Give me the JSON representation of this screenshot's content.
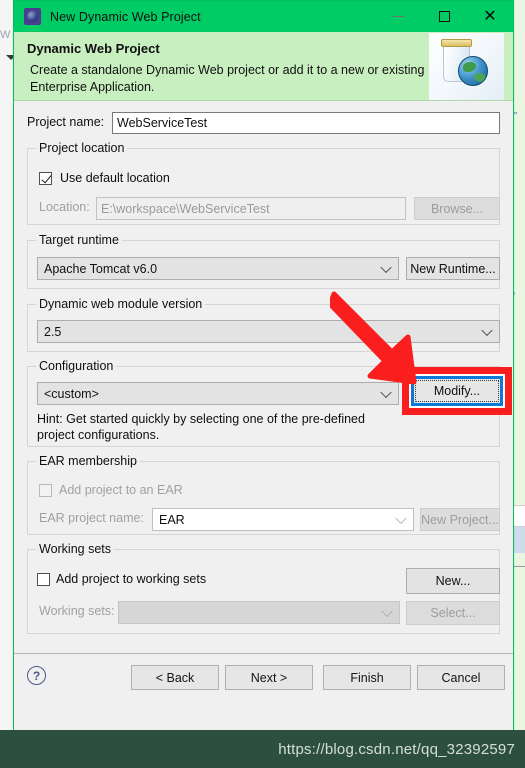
{
  "window": {
    "title": "New Dynamic Web Project",
    "icon": "eclipse-project-icon",
    "minimize_label": "",
    "maximize_label": "",
    "close_label": "✕"
  },
  "banner": {
    "title": "Dynamic Web Project",
    "description": "Create a standalone Dynamic Web project or add it to a new or existing Enterprise Application.",
    "icon": "jar-globe-icon",
    "bg_color": "#c8efc0"
  },
  "form": {
    "project_name": {
      "label": "Project name:",
      "value": "WebServiceTest",
      "placeholder": ""
    },
    "project_location": {
      "group_title": "Project location",
      "use_default_label": "Use default location",
      "use_default_checked": true,
      "location_label": "Location:",
      "location_value": "E:\\workspace\\WebServiceTest",
      "browse_label": "Browse..."
    },
    "target_runtime": {
      "group_title": "Target runtime",
      "value": "Apache Tomcat v6.0",
      "new_runtime_label": "New Runtime..."
    },
    "module_version": {
      "group_title": "Dynamic web module version",
      "value": "2.5"
    },
    "configuration": {
      "group_title": "Configuration",
      "value": "<custom>",
      "modify_label": "Modify...",
      "hint": "Hint: Get started quickly by selecting one of the pre-defined project configurations."
    },
    "ear_membership": {
      "group_title": "EAR membership",
      "add_to_ear_label": "Add project to an EAR",
      "add_to_ear_checked": false,
      "ear_project_name_label": "EAR project name:",
      "ear_project_name_value": "EAR",
      "new_project_label": "New Project..."
    },
    "working_sets": {
      "group_title": "Working sets",
      "add_to_working_sets_label": "Add project to working sets",
      "add_to_working_sets_checked": false,
      "new_label": "New...",
      "working_sets_label": "Working sets:",
      "working_sets_value": "",
      "select_label": "Select..."
    }
  },
  "footer": {
    "help_label": "?",
    "back_label": "< Back",
    "next_label": "Next >",
    "finish_label": "Finish",
    "cancel_label": "Cancel"
  },
  "annotations": {
    "arrow_color": "#fb1e1e",
    "highlight_box_color": "#fb1e1e",
    "focus_border_color": "#0b7ad6",
    "target": "Modify..."
  },
  "watermark": {
    "text": "https://blog.csdn.net/qq_32392597",
    "bg_color": "#2d4f3f",
    "text_color": "#d6ded9"
  },
  "background": {
    "left_fragment": "W",
    "right_fragment": "e"
  }
}
